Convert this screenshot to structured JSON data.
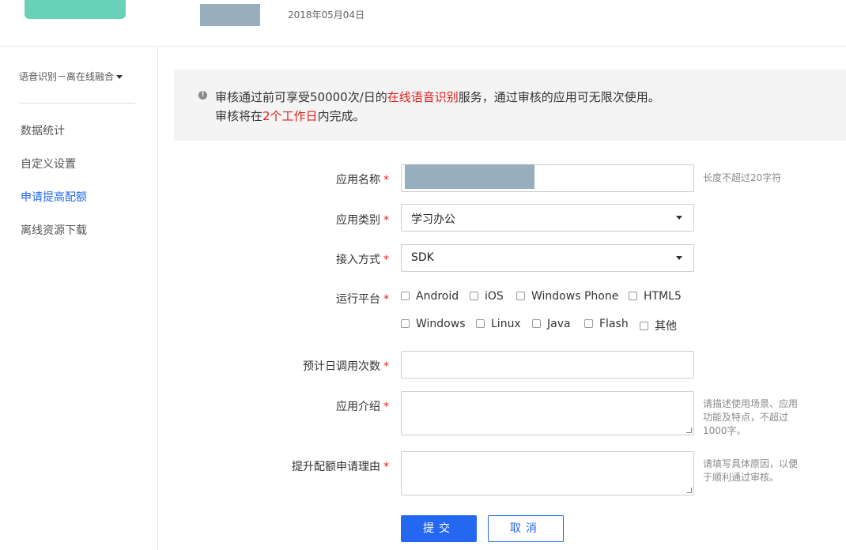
{
  "header": {
    "date": "2018年05月04日"
  },
  "sidebar": {
    "app_selector": "语音识别－离在线融合",
    "items": [
      {
        "label": "数据统计",
        "active": false
      },
      {
        "label": "自定义设置",
        "active": false
      },
      {
        "label": "申请提高配额",
        "active": true
      },
      {
        "label": "离线资源下载",
        "active": false
      }
    ]
  },
  "notice": {
    "line1_pre": "审核通过前可享受50000次/日的",
    "line1_highlight": "在线语音识别",
    "line1_post": "服务，通过审核的应用可无限次使用。",
    "line2_pre": "审核将在",
    "line2_highlight": "2个工作日",
    "line2_post": "内完成。"
  },
  "form": {
    "app_name": {
      "label": "应用名称",
      "hint": "长度不超过20字符"
    },
    "app_category": {
      "label": "应用类别",
      "value": "学习办公"
    },
    "access_method": {
      "label": "接入方式",
      "value": "SDK"
    },
    "platform": {
      "label": "运行平台",
      "options": [
        "Android",
        "iOS",
        "Windows Phone",
        "HTML5",
        "Windows",
        "Linux",
        "Java",
        "Flash",
        "其他"
      ]
    },
    "daily_calls": {
      "label": "预计日调用次数",
      "value": ""
    },
    "app_intro": {
      "label": "应用介绍",
      "hint_line1": "请描述使用场景、应用",
      "hint_line2": "功能及特点，不超过",
      "hint_line3": "1000字。"
    },
    "reason": {
      "label": "提升配额申请理由",
      "hint_line1": "请填写具体原因，以便",
      "hint_line2": "于顺利通过审核。"
    },
    "required_mark": "*"
  },
  "actions": {
    "submit": "提交",
    "cancel": "取消"
  },
  "colors": {
    "accent": "#2468f2",
    "required": "#e0201c",
    "logo": "#69d1b7"
  }
}
